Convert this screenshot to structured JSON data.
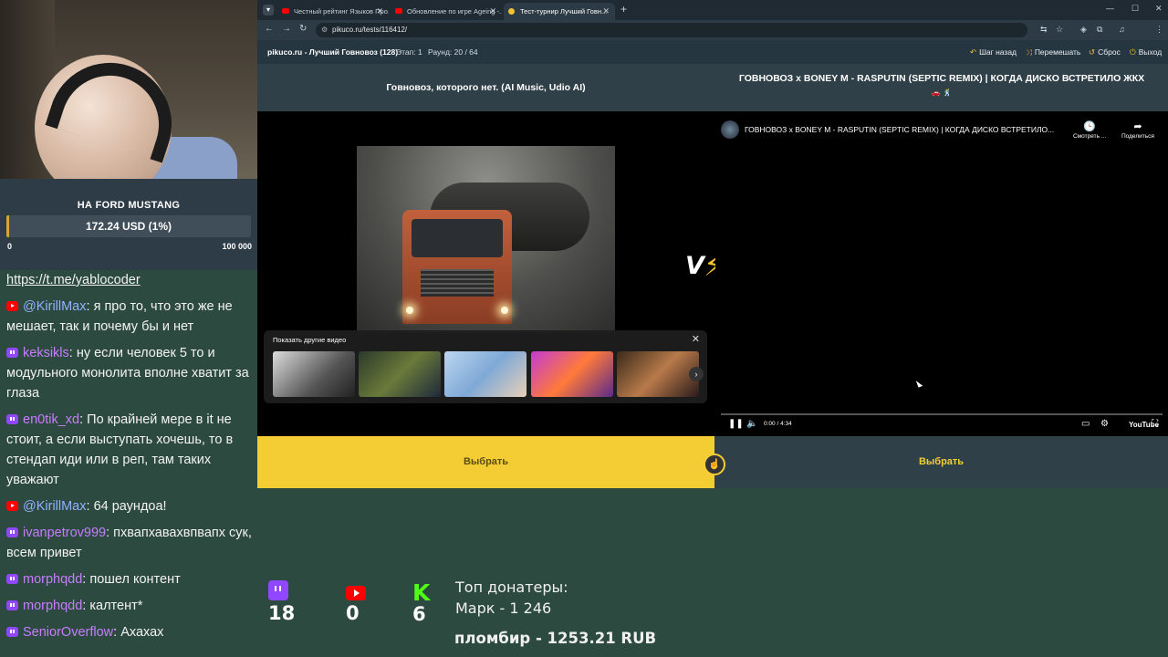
{
  "goal": {
    "title": "НА FORD MUSTANG",
    "amount": "172.24 USD (1%)",
    "progress_percent": 1,
    "min": "0",
    "max": "100 000"
  },
  "chat": {
    "link": "https://t.me/yablocoder",
    "messages": [
      {
        "platform": "youtube",
        "user": "@KirillMax",
        "text": "я про то, что это же не мешает, так и почему бы и нет"
      },
      {
        "platform": "twitch",
        "user": "keksikls",
        "text": "ну если человек 5 то и модульного монолита вполне хватит за глаза"
      },
      {
        "platform": "twitch",
        "user": "en0tik_xd",
        "text": "По крайней мере в it не стоит, а если выступать хочешь, то в стендап иди или в реп, там таких уважают"
      },
      {
        "platform": "youtube",
        "user": "@KirillMax",
        "text": "64 раундоа!"
      },
      {
        "platform": "twitch",
        "user": "ivanpetrov999",
        "text": "пхвапхавахвпвапх сук, всем привет"
      },
      {
        "platform": "twitch",
        "user": "morphqdd",
        "text": "пошел контент"
      },
      {
        "platform": "twitch",
        "user": "morphqdd",
        "text": "калтент*"
      },
      {
        "platform": "twitch",
        "user": "SeniorOverflow",
        "text": "Ахахах"
      }
    ]
  },
  "browser": {
    "tabs": [
      {
        "title": "Честный рейтинг Языков Про...",
        "active": false
      },
      {
        "title": "Обновление по игре Ageing -...",
        "active": false
      },
      {
        "title": "Тест-турнир Лучший Говн...",
        "active": true
      }
    ],
    "url": "pikuco.ru/tests/116412/"
  },
  "site": {
    "brand": "pikuco.ru - Лучший Говновоз (128)",
    "stage": "Этап: 1",
    "round": "Раунд: 20 / 64",
    "actions": {
      "back": "Шаг назад",
      "shuffle": "Перемешать",
      "reset": "Сброс",
      "exit": "Выход"
    },
    "left_title": "Говновоз, которого нет. (AI Music, Udio AI)",
    "right_title": "ГОВНОВОЗ x BONEY M - RASPUTIN (SEPTIC REMIX) | КОГДА ДИСКО ВСТРЕТИЛО ЖКХ",
    "right_title_emoji": "🚗 🕺",
    "more_videos": "Показать другие видео",
    "vs": {
      "v": "V",
      "s": "S"
    },
    "choose_left": "Выбрать",
    "choose_right": "Выбрать"
  },
  "player": {
    "title": "ГОВНОВОЗ x BONEY M - RASPUTIN (SEPTIC REMIX) | КОГДА ДИСКО ВСТРЕТИЛО...",
    "watch_later": "Смотреть ...",
    "share": "Поделиться",
    "time": "0:00 / 4:34",
    "logo": "YouTube"
  },
  "overlay": {
    "twitch_count": "18",
    "youtube_count": "0",
    "kick_count": "6",
    "donors_title": "Топ донатеры:",
    "top_donor": "Марк - 1 246",
    "last_donation": "пломбир - 1253.21 RUB"
  },
  "colors": {
    "accent": "#f4cd35",
    "background": "#2d4a40",
    "twitch": "#9146ff",
    "youtube": "#ff0000",
    "kick": "#53fc18"
  }
}
